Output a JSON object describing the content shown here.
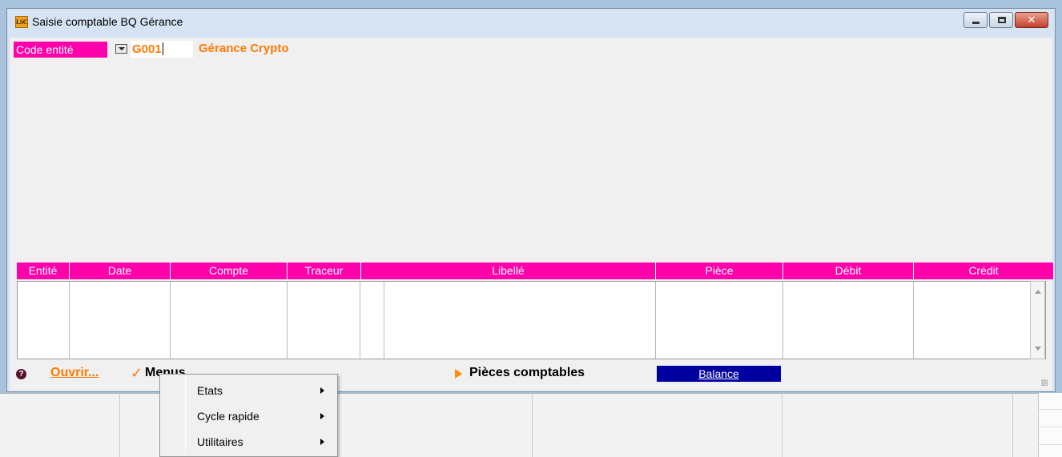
{
  "window": {
    "title": "Saisie comptable BQ Gérance",
    "app_icon_text": "LSC",
    "close_glyph": "✕"
  },
  "entity": {
    "label": "Code entité",
    "code": "G001",
    "name": "Gérance Crypto"
  },
  "table": {
    "columns": [
      "Entité",
      "Date",
      "Compte",
      "Traceur",
      "Libellé",
      "Pièce",
      "Débit",
      "Crédit"
    ]
  },
  "bottom_bar": {
    "help_glyph": "?",
    "open_label": "Ouvrir...",
    "menus_check": "✓",
    "menus_label": "Menus",
    "pieces_label": "Pièces comptables",
    "balance_label": "Balance"
  },
  "popup_menu": {
    "items": [
      {
        "label": "Etats"
      },
      {
        "label": "Cycle rapide"
      },
      {
        "label": "Utilitaires"
      }
    ]
  },
  "colors": {
    "accent_pink": "#ff00aa",
    "accent_orange": "#ff7a00",
    "balance_blue": "#0000a0"
  }
}
